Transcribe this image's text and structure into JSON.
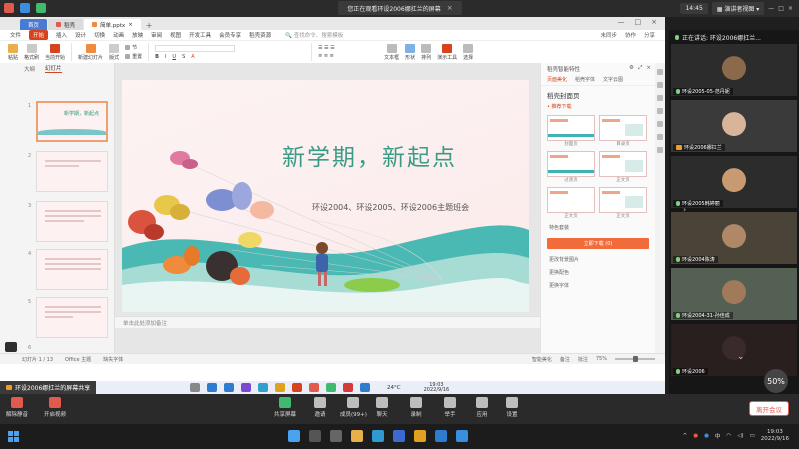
{
  "meeting": {
    "share_banner": "您正在观看环设2006娜扛兰的屏幕",
    "time": "14:45",
    "view_label": "演讲者视图",
    "speaker_tag": "环设2006娜扛兰的屏幕共享",
    "speaking_now": "正在讲话: 环设2006娜扛兰...",
    "volume_percent": "50%",
    "toolbar": [
      {
        "label": "解除静音",
        "icon": "mic-muted-icon"
      },
      {
        "label": "开启视频",
        "icon": "video-off-icon"
      },
      {
        "label": "共享屏幕",
        "icon": "share-screen-icon"
      },
      {
        "label": "邀请",
        "icon": "invite-icon"
      },
      {
        "label": "成员(99+)",
        "icon": "members-icon"
      },
      {
        "label": "聊天",
        "icon": "chat-icon"
      },
      {
        "label": "录制",
        "icon": "record-icon"
      },
      {
        "label": "举手",
        "icon": "raise-hand-icon"
      },
      {
        "label": "应用",
        "icon": "apps-icon"
      },
      {
        "label": "设置",
        "icon": "settings-icon"
      }
    ],
    "leave_label": "离开会议",
    "participants": [
      {
        "name": "环设2005-05-范丹妮"
      },
      {
        "name": "环设2006娜扛兰"
      },
      {
        "name": "环设2005韩婷丽"
      },
      {
        "name": "环设2004陈涛"
      },
      {
        "name": "环设2004-31-孙佳成"
      },
      {
        "name": "环设2006"
      }
    ]
  },
  "wps": {
    "tabs": [
      {
        "label": "首页"
      },
      {
        "label": "稻壳"
      },
      {
        "label": "简单.pptx"
      }
    ],
    "menu": [
      "文件",
      "开始",
      "插入",
      "设计",
      "切换",
      "动画",
      "放映",
      "审阅",
      "视图",
      "开发工具",
      "会员专享",
      "稻壳资源"
    ],
    "menu_active": "开始",
    "search_placeholder": "查找命令、搜索模板",
    "menu_right": [
      "未同步",
      "协作",
      "分享"
    ],
    "ribbon": [
      "粘贴",
      "格式刷",
      "当前开始",
      "新建幻灯片",
      "版式",
      "节",
      "重置",
      "文本框",
      "形状",
      "排列",
      "演示工具",
      "选择"
    ],
    "thumb_tabs": [
      "大纲",
      "幻灯片"
    ],
    "thumb_title": "新学期，新起点",
    "slide_title": "新学期，新起点",
    "slide_subtitle": "环设2004、环设2005、环设2006主题班会",
    "notes_placeholder": "单击此处添加备注",
    "status_left": [
      "幻灯片 1 / 13",
      "Office 主题",
      "缺失字体"
    ],
    "status_right": [
      "智能美化",
      "备注",
      "批注"
    ],
    "zoom": "75%",
    "zoom_fraction": 0.5
  },
  "design_panel": {
    "header": "稻壳智能特性",
    "tabs": [
      "页面美化",
      "稻壳字体",
      "文字云图"
    ],
    "section_title": "稻壳封面页",
    "subsection": "• 推荐下载",
    "cards": [
      "封面页",
      "目录页",
      "过渡页",
      "正文页",
      "正文页",
      "正文页"
    ],
    "feature_label": "特色套装",
    "apply_button": "立即下载 (0)",
    "extra_items": [
      "更改背景图片",
      "更换配色",
      "更换字体"
    ]
  },
  "inner_taskbar": {
    "temperature": "24°C",
    "clock_time": "19:03",
    "clock_date": "2022/9/16"
  },
  "os_taskbar": {
    "lang": "中",
    "clock_time": "19:03",
    "clock_date": "2022/9/16"
  }
}
